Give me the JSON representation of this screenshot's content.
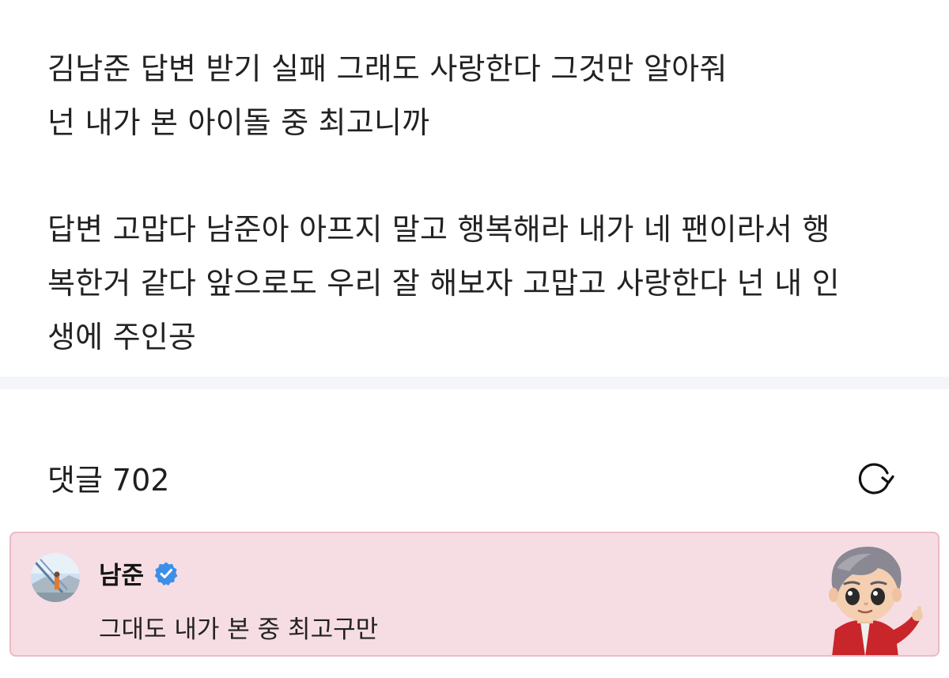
{
  "post": {
    "paragraphs": [
      {
        "lines": [
          "김남준 답변 받기 실패 그래도 사랑한다 그것만 알아줘",
          "넌 내가 본 아이돌 중 최고니까"
        ]
      },
      {
        "lines": [
          "답변 고맙다 남준아 아프지 말고 행복해라 내가 네 팬이라서 행",
          "복한거 같다 앞으로도 우리 잘 해보자 고맙고 사랑한다 넌 내 인",
          "생에 주인공"
        ]
      }
    ]
  },
  "comments": {
    "label": "댓글",
    "count": "702",
    "refresh_icon": "refresh-icon"
  },
  "highlighted_comment": {
    "author": "남준",
    "verified_icon": "verified-badge-icon",
    "text": "그대도 내가 본 중 최고구만",
    "background_color": "#f6dde3",
    "border_color": "#ecbac6",
    "badge_color": "#3d8ee8"
  }
}
